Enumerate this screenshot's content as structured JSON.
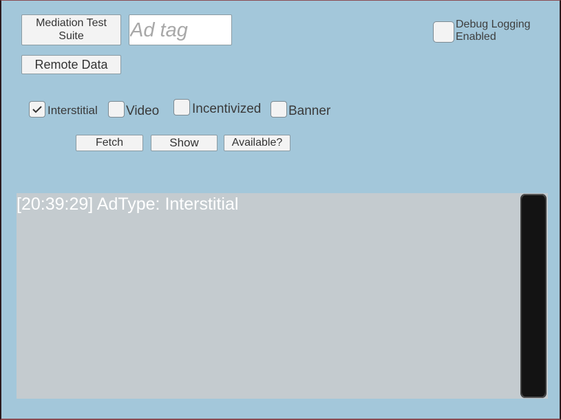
{
  "top_buttons": {
    "mediation_test_suite": "Mediation Test\nSuite",
    "mediation_line1": "Mediation Test",
    "mediation_line2": "Suite",
    "remote_data": "Remote Data"
  },
  "ad_tag_field": {
    "value": "",
    "placeholder": "Ad tag"
  },
  "debug_logging": {
    "line1": "Debug Logging",
    "line2": "Enabled",
    "checked": false
  },
  "ad_types": [
    {
      "label": "Interstitial",
      "checked": true
    },
    {
      "label": "Video",
      "checked": false
    },
    {
      "label": "Incentivized",
      "checked": false
    },
    {
      "label": "Banner",
      "checked": false
    }
  ],
  "actions": {
    "fetch": "Fetch",
    "show": "Show",
    "available": "Available?"
  },
  "log": {
    "lines": [
      "[20:39:29] AdType: Interstitial"
    ],
    "line0": "[20:39:29] AdType: Interstitial"
  },
  "colors": {
    "background": "#a3c7da",
    "log_background": "#c4cbcf",
    "log_text": "#ffffff",
    "scroll_thumb": "#131313"
  }
}
